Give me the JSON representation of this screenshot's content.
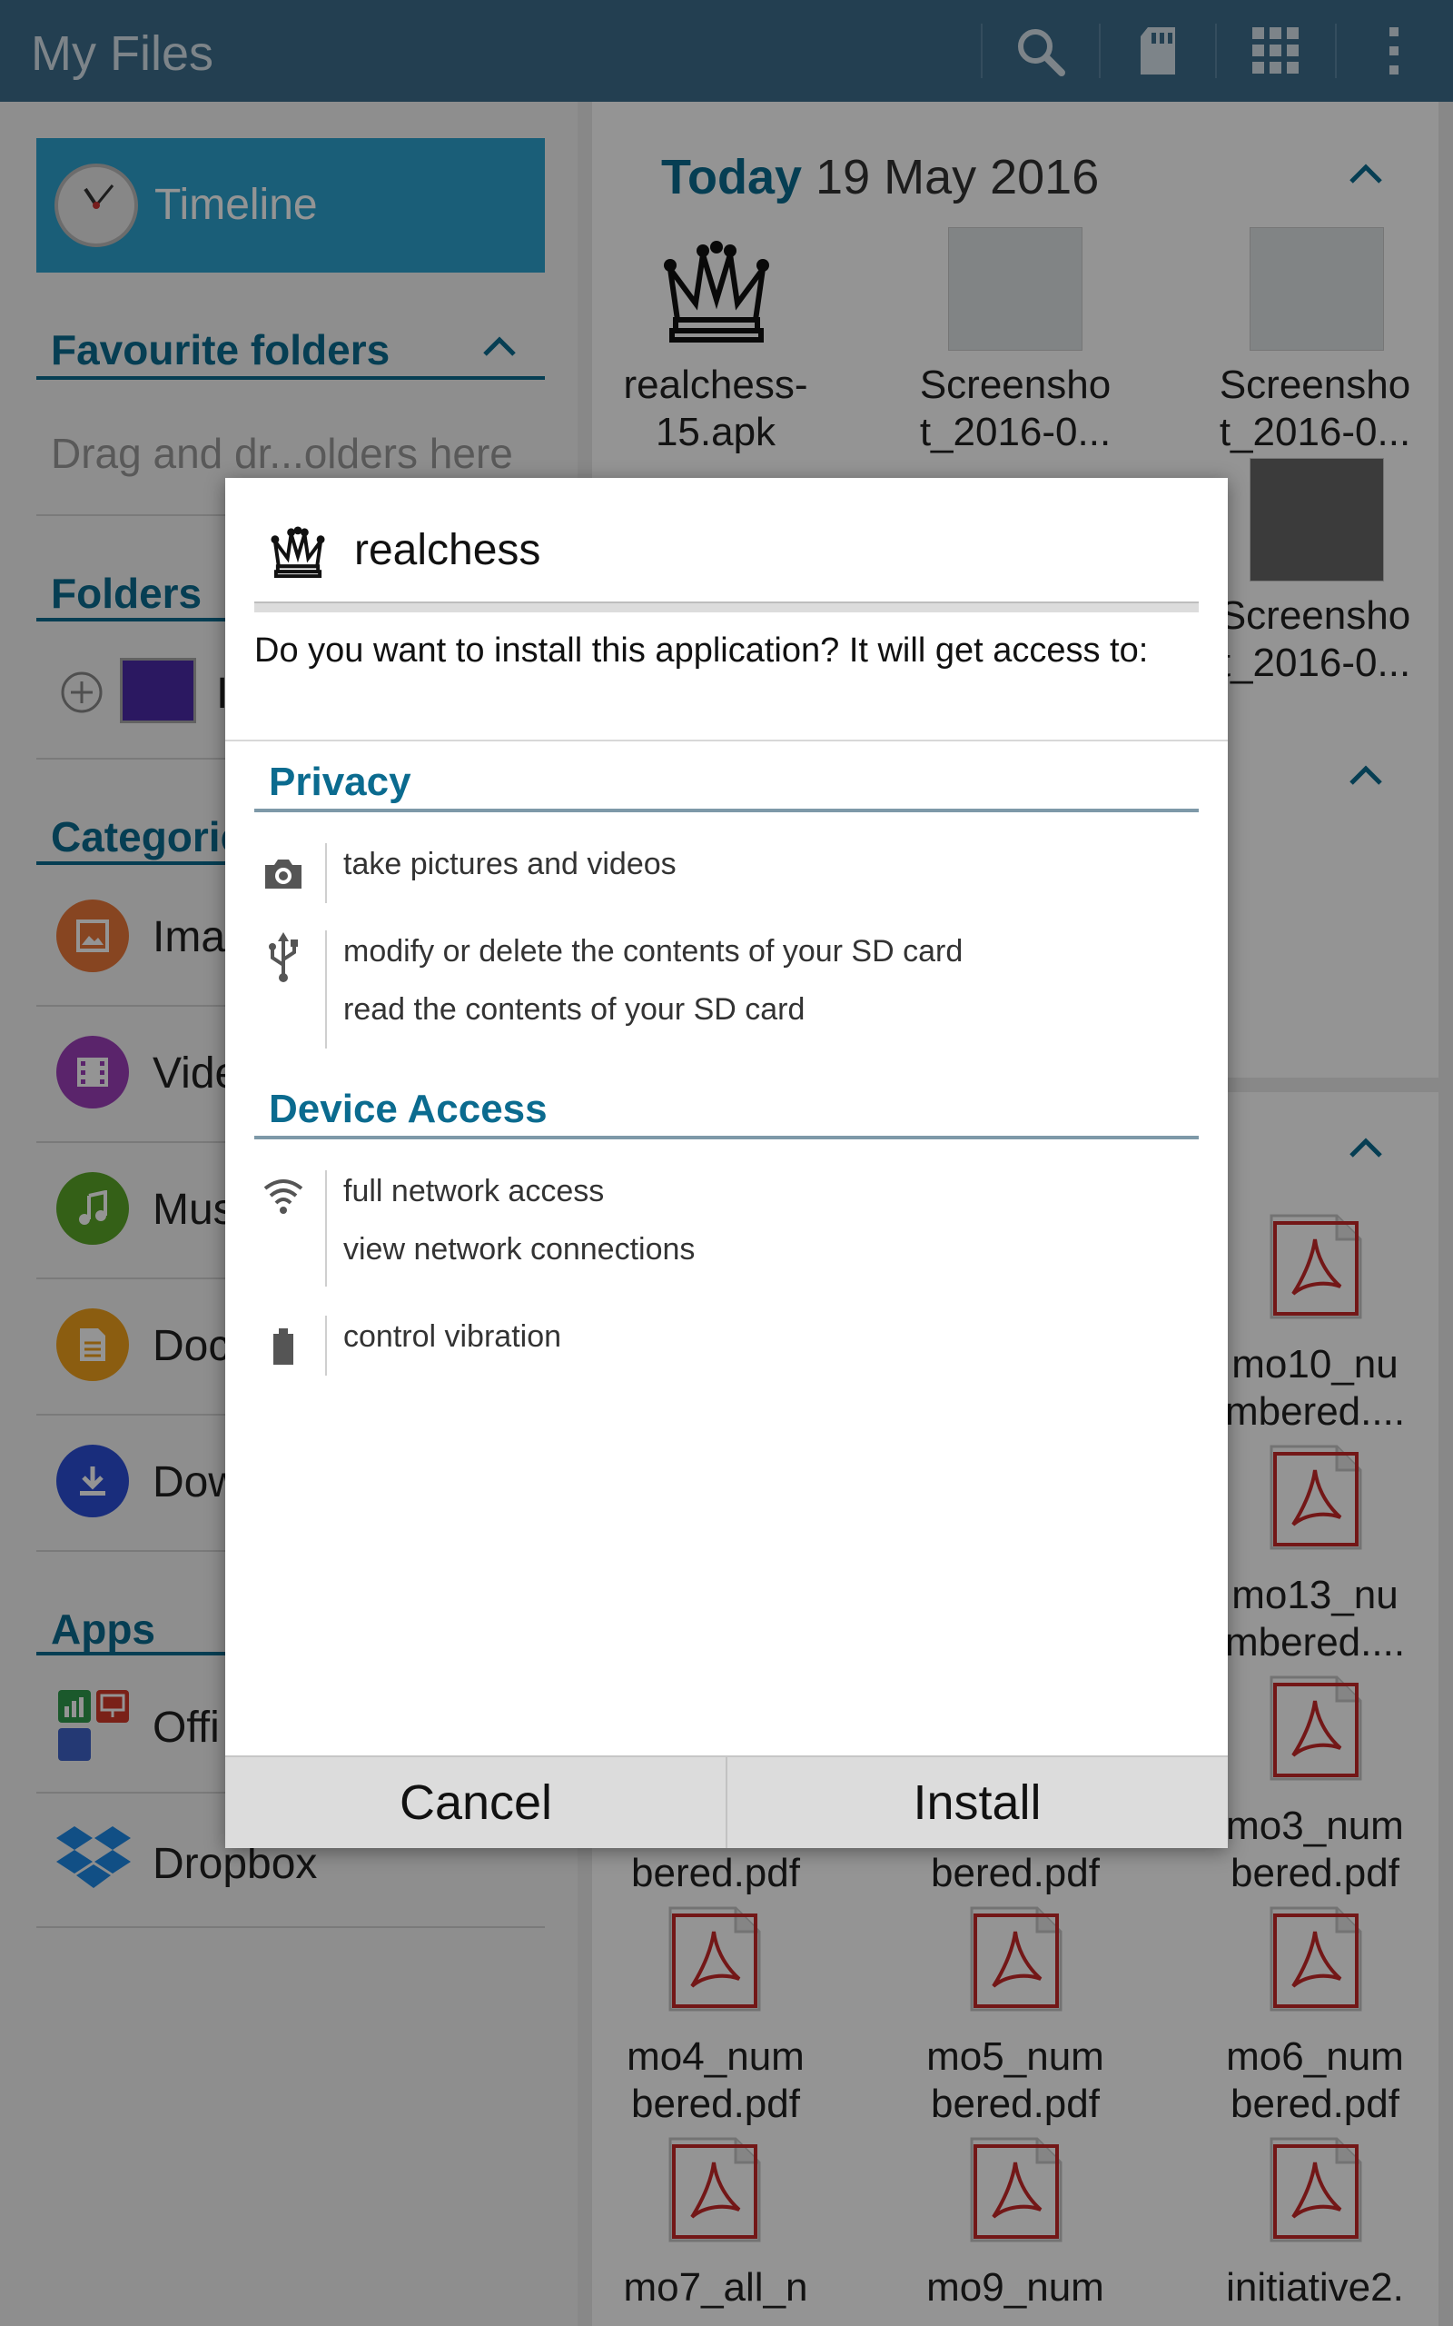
{
  "app_bar": {
    "title": "My Files",
    "actions": [
      "search-icon",
      "sd-card-icon",
      "grid-view-icon",
      "more-options-icon"
    ]
  },
  "sidebar": {
    "timeline_label": "Timeline",
    "favourite_folders_header": "Favourite folders",
    "favourite_folders_hint": "Drag and dr...olders here",
    "folders_header": "Folders",
    "folders_first_item_partial": "I",
    "categories_header": "Categorie",
    "categories": [
      {
        "label": "Ima",
        "icon": "image-icon",
        "color": "#e8773a"
      },
      {
        "label": "Vide",
        "icon": "video-icon",
        "color": "#9c3fb8"
      },
      {
        "label": "Mus",
        "icon": "music-icon",
        "color": "#5aa528"
      },
      {
        "label": "Doc",
        "icon": "document-icon",
        "color": "#f0a01c"
      },
      {
        "label": "Dow",
        "icon": "download-icon",
        "color": "#2c4fd6"
      }
    ],
    "apps_header": "Apps",
    "apps": [
      {
        "label": "Offi",
        "icon": "office-icon"
      },
      {
        "label": "Dropbox",
        "icon": "dropbox-icon"
      }
    ]
  },
  "main": {
    "today_label": "Today",
    "today_date": "19 May 2016",
    "row1": [
      {
        "name": "realchess-\n15.apk"
      },
      {
        "name": "Screensho\nt_2016-0..."
      },
      {
        "name": "Screensho\nt_2016-0..."
      }
    ],
    "row2_right": {
      "name": "Screensho\nt_2016-0..."
    },
    "pdf_right_col": [
      {
        "name": "mo10_nu\nmbered...."
      },
      {
        "name": "mo13_nu\nmbered...."
      },
      {
        "name": "mo3_num\nbered.pdf"
      }
    ],
    "pdf_bottom_partial_row": [
      {
        "name": "bered.pdf"
      },
      {
        "name": "bered.pdf"
      }
    ],
    "pdf_row_a": [
      {
        "name": "mo4_num\nbered.pdf"
      },
      {
        "name": "mo5_num\nbered.pdf"
      },
      {
        "name": "mo6_num\nbered.pdf"
      }
    ],
    "pdf_row_b": [
      {
        "name": "mo7_all_n"
      },
      {
        "name": "mo9_num"
      },
      {
        "name": "initiative2."
      }
    ]
  },
  "dialog": {
    "app_name": "realchess",
    "question": "Do you want to install this application? It will get access to:",
    "sections": [
      {
        "title": "Privacy",
        "groups": [
          {
            "icon": "camera-icon",
            "items": [
              "take pictures and videos"
            ]
          },
          {
            "icon": "usb-icon",
            "items": [
              "modify or delete the contents of your SD card",
              "read the contents of your SD card"
            ]
          }
        ]
      },
      {
        "title": "Device Access",
        "groups": [
          {
            "icon": "wifi-icon",
            "items": [
              "full network access",
              "view network connections"
            ]
          },
          {
            "icon": "battery-icon",
            "items": [
              "control vibration"
            ]
          }
        ]
      }
    ],
    "cancel_label": "Cancel",
    "install_label": "Install"
  }
}
